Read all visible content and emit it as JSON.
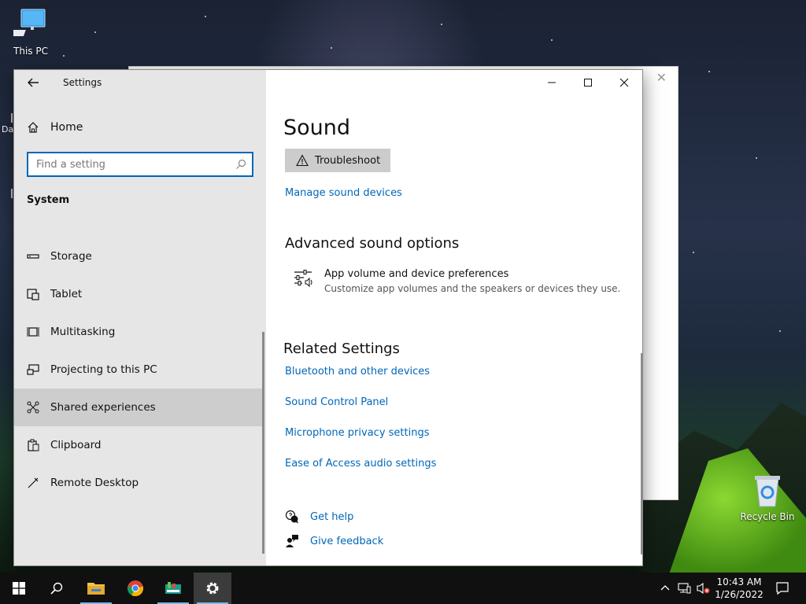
{
  "desktop": {
    "icons": [
      {
        "label": "This PC"
      },
      {
        "label": "Recycle Bin"
      }
    ],
    "partial_label": "Da"
  },
  "settings": {
    "app_title": "Settings",
    "home_label": "Home",
    "search_placeholder": "Find a setting",
    "section_label": "System",
    "nav_items": [
      {
        "label": "Storage",
        "icon": "storage-icon"
      },
      {
        "label": "Tablet",
        "icon": "tablet-icon"
      },
      {
        "label": "Multitasking",
        "icon": "multitasking-icon"
      },
      {
        "label": "Projecting to this PC",
        "icon": "projecting-icon"
      },
      {
        "label": "Shared experiences",
        "icon": "shared-experiences-icon",
        "active": true
      },
      {
        "label": "Clipboard",
        "icon": "clipboard-icon"
      },
      {
        "label": "Remote Desktop",
        "icon": "remote-desktop-icon"
      }
    ],
    "content": {
      "page_title": "Sound",
      "troubleshoot_label": "Troubleshoot",
      "manage_devices_link": "Manage sound devices",
      "advanced_heading": "Advanced sound options",
      "app_volume_title": "App volume and device preferences",
      "app_volume_desc": "Customize app volumes and the speakers or devices they use.",
      "related_heading": "Related Settings",
      "related_links": [
        "Bluetooth and other devices",
        "Sound Control Panel",
        "Microphone privacy settings",
        "Ease of Access audio settings"
      ],
      "get_help": "Get help",
      "give_feedback": "Give feedback"
    }
  },
  "taskbar": {
    "time": "10:43 AM",
    "date": "1/26/2022"
  },
  "colors": {
    "accent": "#0067b8",
    "sidebar_bg": "#e6e6e6",
    "taskbar_bg": "#101010"
  }
}
